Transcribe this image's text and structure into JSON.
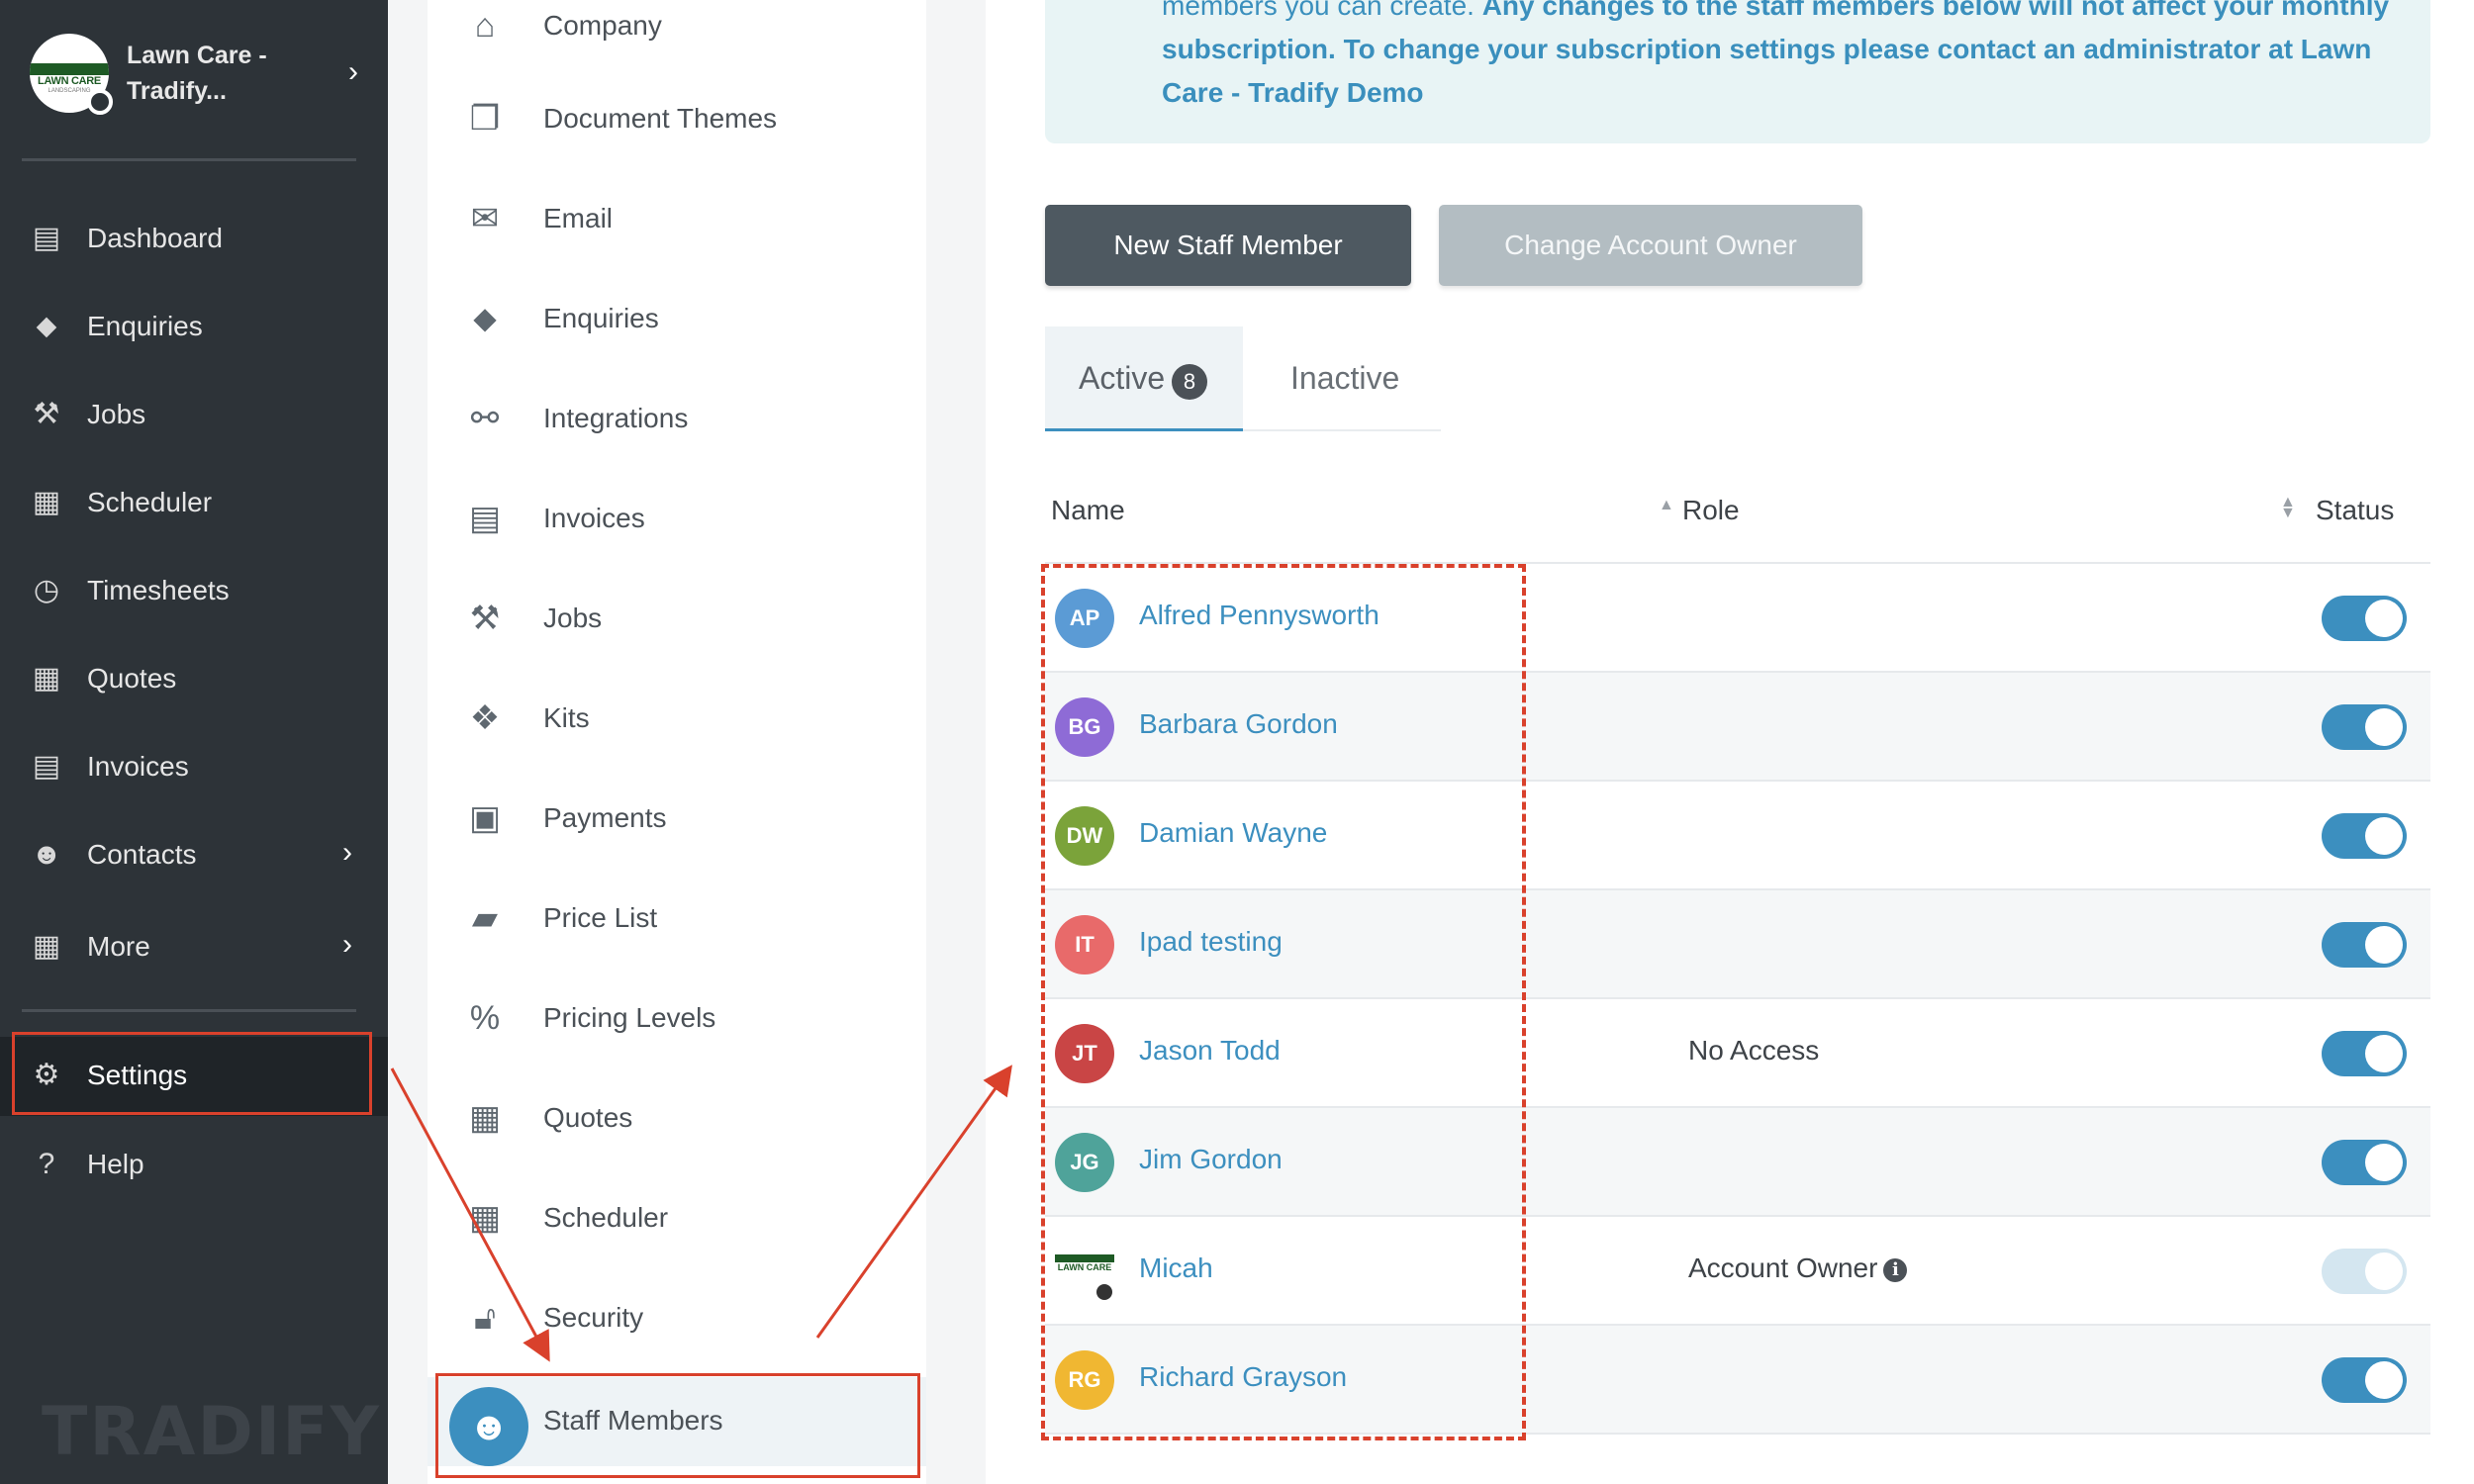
{
  "account": {
    "name": "Lawn Care - Tradify...",
    "logo_text": "LAWN CARE",
    "logo_sub": "LANDSCAPING"
  },
  "nav": [
    {
      "label": "Dashboard",
      "icon": "dashboard-icon"
    },
    {
      "label": "Enquiries",
      "icon": "tag-icon"
    },
    {
      "label": "Jobs",
      "icon": "hammer-icon"
    },
    {
      "label": "Scheduler",
      "icon": "calendar-icon"
    },
    {
      "label": "Timesheets",
      "icon": "clock-icon"
    },
    {
      "label": "Quotes",
      "icon": "calculator-icon"
    },
    {
      "label": "Invoices",
      "icon": "invoice-icon"
    },
    {
      "label": "Contacts",
      "icon": "users-icon"
    },
    {
      "label": "More",
      "icon": "grid-icon"
    },
    {
      "label": "Settings",
      "icon": "gear-icon"
    },
    {
      "label": "Help",
      "icon": "help-icon"
    }
  ],
  "brand": "TRADIFY",
  "settings_menu": [
    {
      "label": "Company"
    },
    {
      "label": "Document Themes"
    },
    {
      "label": "Email"
    },
    {
      "label": "Enquiries"
    },
    {
      "label": "Integrations"
    },
    {
      "label": "Invoices"
    },
    {
      "label": "Jobs"
    },
    {
      "label": "Kits"
    },
    {
      "label": "Payments"
    },
    {
      "label": "Price List"
    },
    {
      "label": "Pricing Levels"
    },
    {
      "label": "Quotes"
    },
    {
      "label": "Scheduler"
    },
    {
      "label": "Security"
    },
    {
      "label": "Staff Members"
    }
  ],
  "banner": {
    "text_plain": "members you can create. ",
    "text_bold": "Any changes to the staff members below will not affect your monthly subscription. To change your subscription settings please contact an administrator at Lawn Care - Tradify Demo"
  },
  "buttons": {
    "new_staff": "New Staff Member",
    "change_owner": "Change Account Owner"
  },
  "tabs": {
    "active": "Active",
    "active_count": "8",
    "inactive": "Inactive"
  },
  "table": {
    "headers": {
      "name": "Name",
      "role": "Role",
      "status": "Status"
    },
    "rows": [
      {
        "initials": "AP",
        "name": "Alfred Pennysworth",
        "role": "",
        "color": "#5b9bd5"
      },
      {
        "initials": "BG",
        "name": "Barbara Gordon",
        "role": "",
        "color": "#8e6bd6"
      },
      {
        "initials": "DW",
        "name": "Damian Wayne",
        "role": "",
        "color": "#7ba33a"
      },
      {
        "initials": "IT",
        "name": "Ipad testing",
        "role": "",
        "color": "#e86a6a"
      },
      {
        "initials": "JT",
        "name": "Jason Todd",
        "role": "No Access",
        "color": "#c94545"
      },
      {
        "initials": "JG",
        "name": "Jim Gordon",
        "role": "",
        "color": "#4fa39a"
      },
      {
        "initials": "",
        "name": "Micah",
        "role": "Account Owner",
        "color": ""
      },
      {
        "initials": "RG",
        "name": "Richard Grayson",
        "role": "",
        "color": "#f0b732"
      }
    ]
  },
  "colors": {
    "accent": "#3c8fbf",
    "annotation": "#d9412c",
    "sidebar": "#2d3338"
  }
}
